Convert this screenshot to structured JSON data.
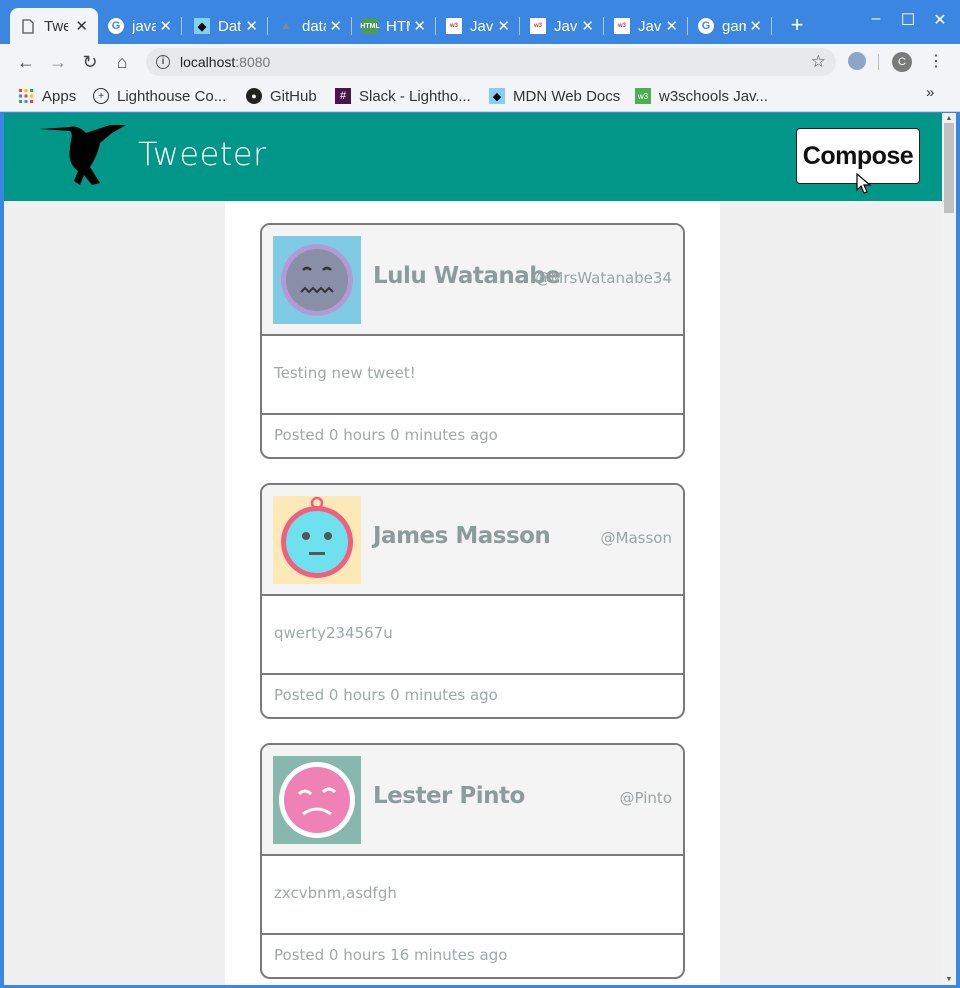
{
  "tabs": [
    {
      "title": "Tweeter",
      "icon": "page-icon",
      "active": true
    },
    {
      "title": "javascript",
      "icon": "google-icon"
    },
    {
      "title": "Data",
      "icon": "mdn-icon"
    },
    {
      "title": "data",
      "icon": "github-icon"
    },
    {
      "title": "HTML",
      "icon": "html-icon"
    },
    {
      "title": "JavaScript",
      "icon": "w3schools-icon"
    },
    {
      "title": "JavaScript",
      "icon": "w3schools-icon"
    },
    {
      "title": "JavaScript",
      "icon": "w3schools-icon"
    },
    {
      "title": "game",
      "icon": "google-icon"
    }
  ],
  "toolbar": {
    "url_host": "localhost",
    "url_port": ":8080",
    "profile_initial": "C"
  },
  "bookmarks": [
    {
      "label": "Apps",
      "icon": "apps-grid-icon"
    },
    {
      "label": "Lighthouse Co...",
      "icon": "lighthouse-icon"
    },
    {
      "label": "GitHub",
      "icon": "github-icon"
    },
    {
      "label": "Slack - Lightho...",
      "icon": "slack-icon"
    },
    {
      "label": "MDN Web Docs",
      "icon": "mdn-icon"
    },
    {
      "label": "w3schools Jav...",
      "icon": "w3schools-icon"
    }
  ],
  "app": {
    "brand": "Tweeter",
    "compose_label": "Compose"
  },
  "tweets": [
    {
      "name": "Lulu Watanabe",
      "handle": "@MrsWatanabe34",
      "text": "Testing new tweet!",
      "time": "Posted 0 hours 0 minutes ago",
      "avatar_bg": "#7ecbe3",
      "avatar_face": "#8a8fa8",
      "avatar_ring": "#b39ad6"
    },
    {
      "name": "James Masson",
      "handle": "@Masson",
      "text": "qwerty234567u",
      "time": "Posted 0 hours 0 minutes ago",
      "avatar_bg": "#fde8b8",
      "avatar_face": "#6fe0ee",
      "avatar_ring": "#f0607c"
    },
    {
      "name": "Lester Pinto",
      "handle": "@Pinto",
      "text": "zxcvbnm,asdfgh",
      "time": "Posted 0 hours 16 minutes ago",
      "avatar_bg": "#86b8ae",
      "avatar_face": "#f081b4",
      "avatar_ring": "#ffffff"
    }
  ],
  "colors": {
    "header": "#009688",
    "chrome_frame": "#3a86e0"
  }
}
